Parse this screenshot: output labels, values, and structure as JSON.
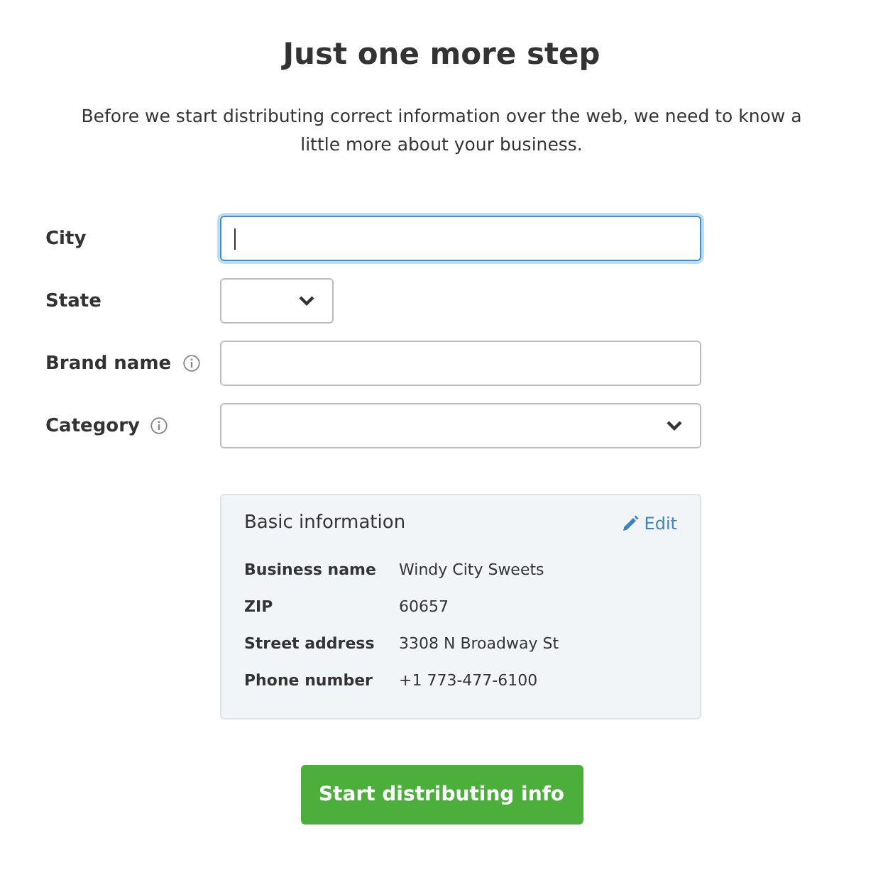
{
  "title": "Just one more step",
  "intro": "Before we start distributing correct information over the web, we need to know a little more about your business.",
  "fields": [
    {
      "label": "City",
      "kind": "text",
      "focused": true,
      "info": false
    },
    {
      "label": "State",
      "kind": "short-select",
      "focused": false,
      "info": false
    },
    {
      "label": "Brand name",
      "kind": "text",
      "focused": false,
      "info": true
    },
    {
      "label": "Category",
      "kind": "select",
      "focused": false,
      "info": true
    }
  ],
  "basic_info": {
    "title": "Basic information",
    "edit": "Edit",
    "rows": [
      {
        "label": "Business name",
        "value": "Windy City Sweets"
      },
      {
        "label": "ZIP",
        "value": "60657"
      },
      {
        "label": "Street address",
        "value": "3308 N Broadway St"
      },
      {
        "label": "Phone number",
        "value": "+1 773-477-6100"
      }
    ]
  },
  "submit": "Start distributing info"
}
